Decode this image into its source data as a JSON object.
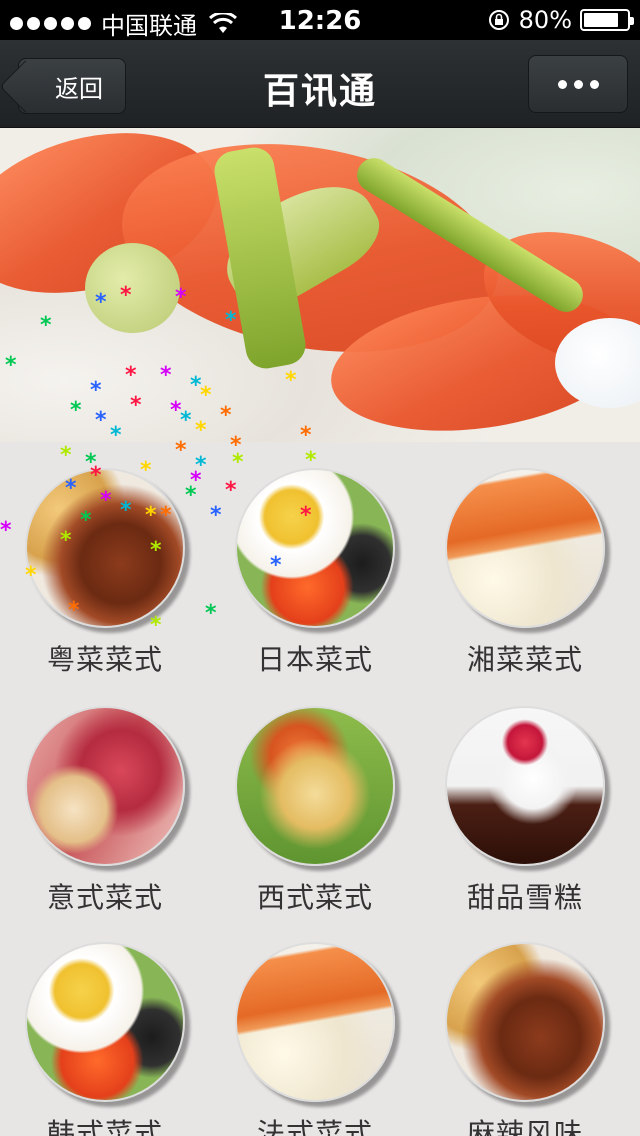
{
  "status_bar": {
    "carrier": "中国联通",
    "time": "12:26",
    "battery": "80%",
    "battery_level": 0.8,
    "icons": [
      "signal-dots-icon",
      "wifi-icon",
      "rotation-lock-icon",
      "battery-icon"
    ]
  },
  "nav": {
    "back_label": "返回",
    "title": "百讯通",
    "more_icon": "more-dots-icon"
  },
  "banner": {
    "description_icon": "food-banner-image"
  },
  "categories": [
    {
      "label": "粤菜菜式",
      "photo": "ph-a"
    },
    {
      "label": "日本菜式",
      "photo": "ph-b"
    },
    {
      "label": "湘菜菜式",
      "photo": "ph-c"
    },
    {
      "label": "意式菜式",
      "photo": "ph-d"
    },
    {
      "label": "西式菜式",
      "photo": "ph-e"
    },
    {
      "label": "甜品雪糕",
      "photo": "ph-f"
    },
    {
      "label": "韩式菜式",
      "photo": "ph-b"
    },
    {
      "label": "法式菜式",
      "photo": "ph-c"
    },
    {
      "label": "麻辣风味",
      "photo": "ph-a"
    }
  ],
  "colors": {
    "status_bg": "#000000",
    "nav_bg": "#25292b",
    "page_bg": "#e8e6e5",
    "label_text": "#333333"
  }
}
